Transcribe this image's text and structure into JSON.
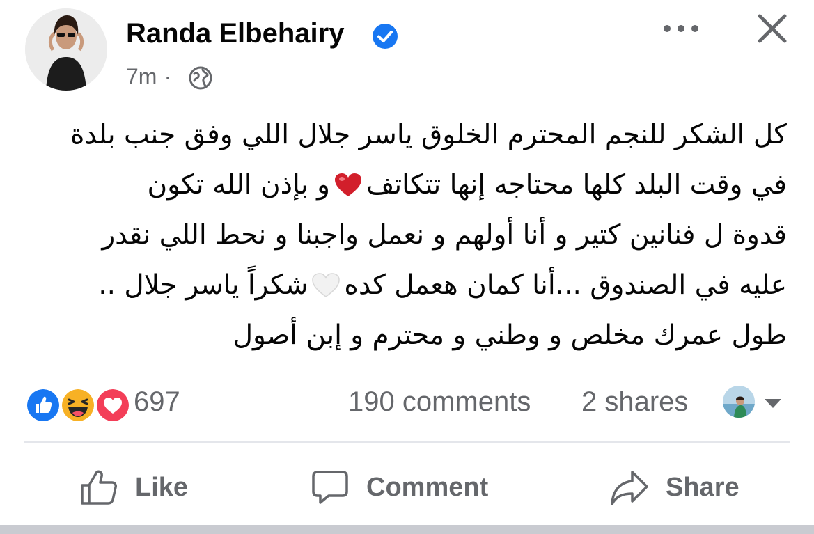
{
  "post": {
    "author": "Randa Elbehairy",
    "time": "7m",
    "separator": "·",
    "body_lines": [
      "كل الشكر للنجم المحترم الخلوق ياسر جلال اللي وفق جنب بلدة",
      "في وقت البلد كلها محتاجه إنها تتكاتف",
      "و بإذن الله تكون",
      "قدوة ل فنانين كتير و أنا أولهم و نعمل واجبنا و نحط اللي نقدر",
      "عليه في الصندوق ...أنا كمان هعمل كده",
      "شكراً ياسر جلال ..",
      "طول عمرك مخلص و وطني و محترم و إبن أصول"
    ]
  },
  "stats": {
    "reaction_count": "697",
    "comments": "190 comments",
    "shares": "2 shares"
  },
  "actions": {
    "like": "Like",
    "comment": "Comment",
    "share": "Share"
  },
  "icons": {
    "verified": "verified-badge-icon",
    "audience": "globe-icon",
    "more": "more-options-icon",
    "close": "close-icon",
    "reactions": [
      "like-reaction-icon",
      "haha-reaction-icon",
      "love-reaction-icon"
    ]
  },
  "colors": {
    "verified_blue": "#1877f2",
    "secondary_text": "#65676b",
    "like_blue": "#1877f2",
    "love_red": "#f33e58",
    "haha_yellow": "#f7b125"
  }
}
